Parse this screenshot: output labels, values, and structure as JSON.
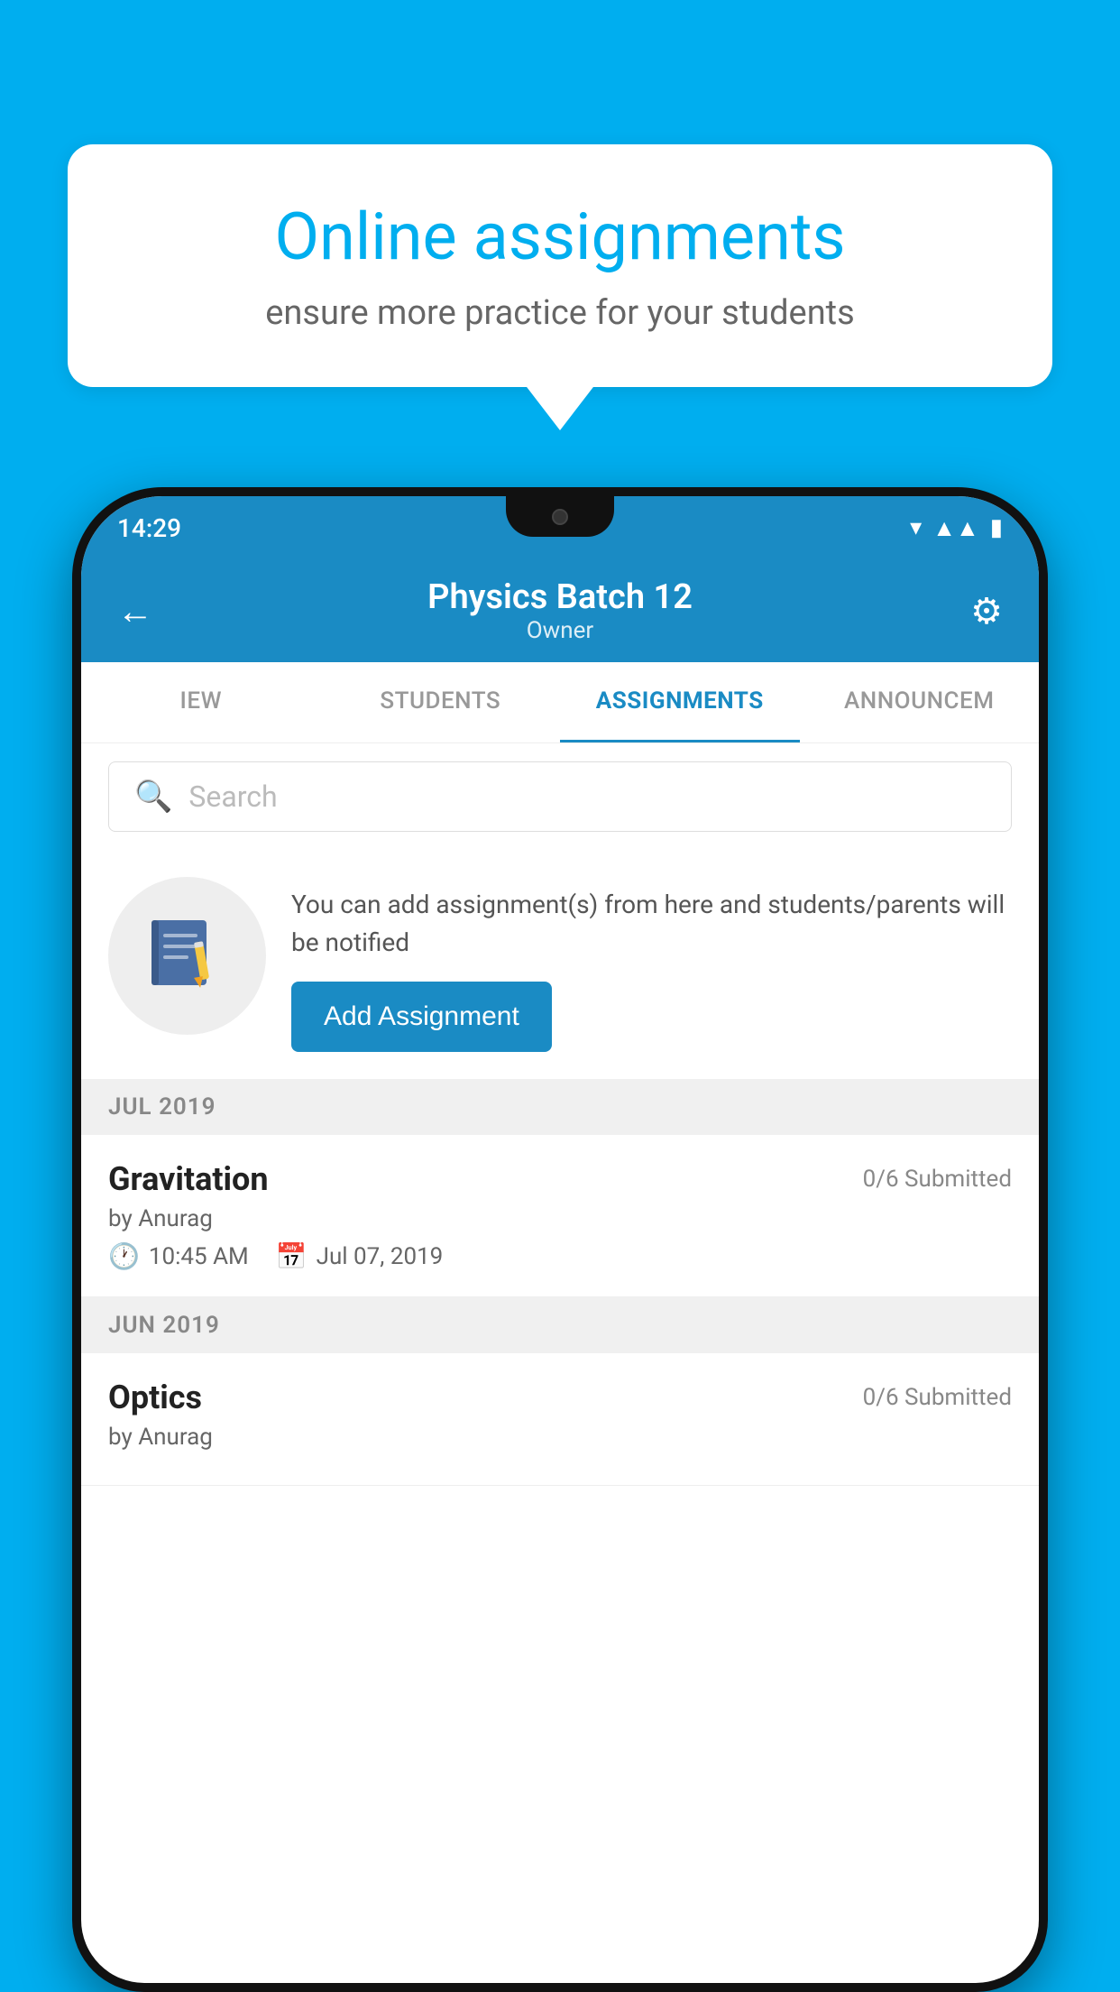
{
  "background": {
    "color": "#00AEEF"
  },
  "speech_bubble": {
    "title": "Online assignments",
    "subtitle": "ensure more practice for your students"
  },
  "phone": {
    "status_bar": {
      "time": "14:29"
    },
    "header": {
      "title": "Physics Batch 12",
      "subtitle": "Owner",
      "back_label": "←",
      "gear_label": "⚙"
    },
    "tabs": [
      {
        "label": "IEW",
        "active": false
      },
      {
        "label": "STUDENTS",
        "active": false
      },
      {
        "label": "ASSIGNMENTS",
        "active": true
      },
      {
        "label": "ANNOUNCEM",
        "active": false
      }
    ],
    "search": {
      "placeholder": "Search"
    },
    "add_assignment": {
      "description": "You can add assignment(s) from here and students/parents will be notified",
      "button_label": "Add Assignment"
    },
    "sections": [
      {
        "month_label": "JUL 2019",
        "assignments": [
          {
            "name": "Gravitation",
            "submitted": "0/6 Submitted",
            "by": "by Anurag",
            "time": "10:45 AM",
            "date": "Jul 07, 2019"
          }
        ]
      },
      {
        "month_label": "JUN 2019",
        "assignments": [
          {
            "name": "Optics",
            "submitted": "0/6 Submitted",
            "by": "by Anurag",
            "time": "",
            "date": ""
          }
        ]
      }
    ]
  }
}
